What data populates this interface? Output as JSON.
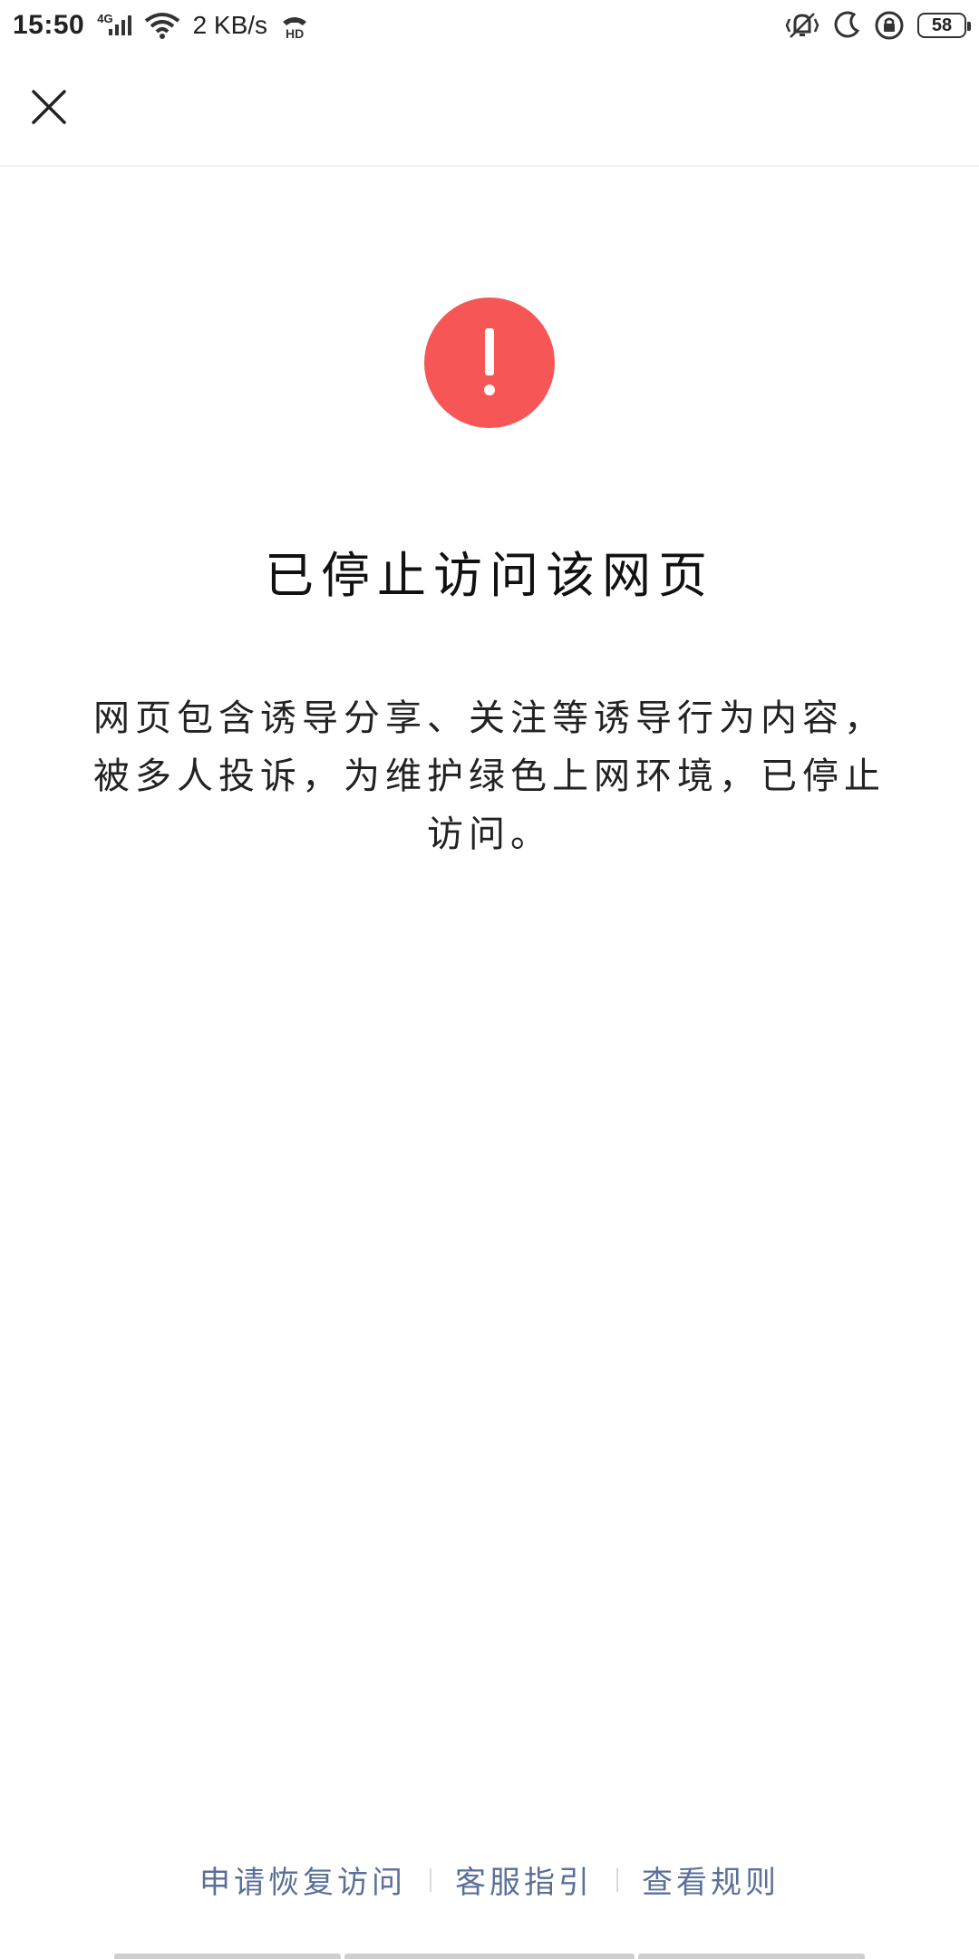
{
  "status_bar": {
    "time": "15:50",
    "network": "4G",
    "speed": "2 KB/s",
    "battery": "58"
  },
  "page": {
    "title": "已停止访问该网页",
    "description": "网页包含诱导分享、关注等诱导行为内容，被多人投诉，为维护绿色上网环境，已停止访问。"
  },
  "footer": {
    "links": [
      "申请恢复访问",
      "客服指引",
      "查看规则"
    ]
  },
  "colors": {
    "alert": "#f65656",
    "link": "#5b6f97"
  }
}
